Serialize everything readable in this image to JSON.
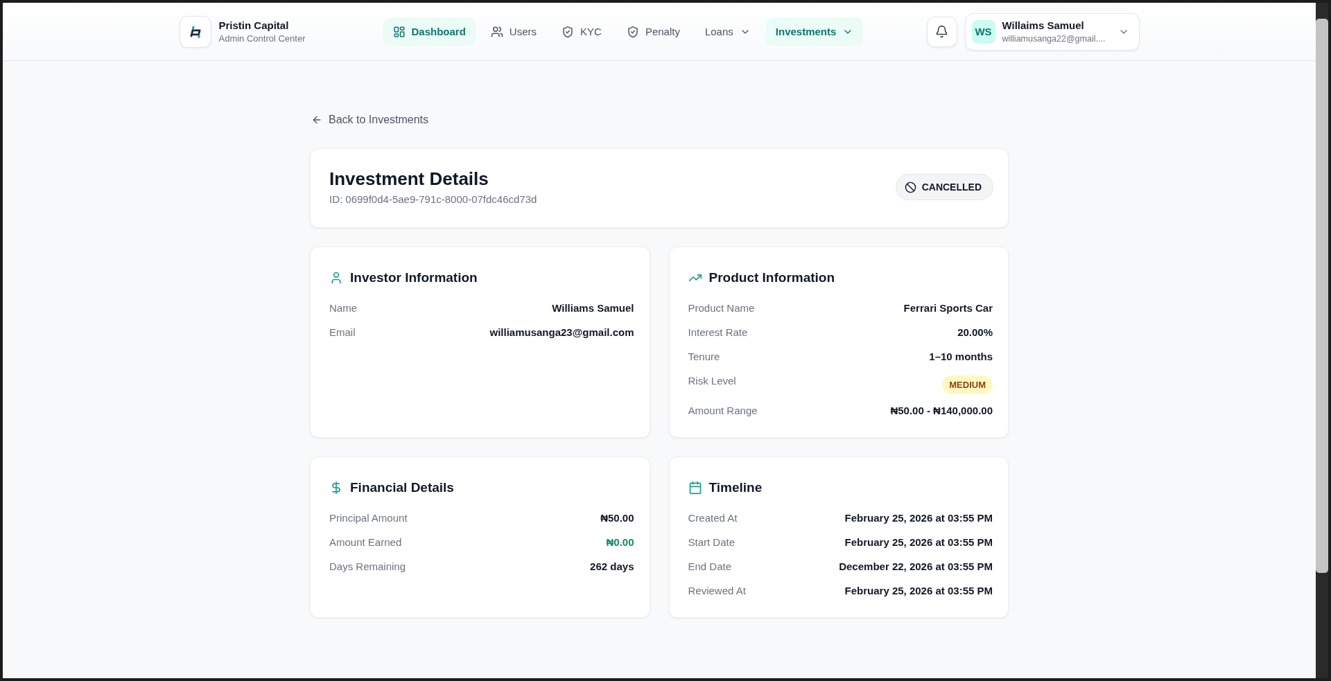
{
  "header": {
    "brand": {
      "name": "Pristin Capital",
      "subtitle": "Admin Control Center"
    },
    "nav": [
      {
        "label": "Dashboard",
        "kind": "link",
        "selected": true
      },
      {
        "label": "Users",
        "kind": "link",
        "selected": false
      },
      {
        "label": "KYC",
        "kind": "link",
        "selected": false
      },
      {
        "label": "Penalty",
        "kind": "link",
        "selected": false
      },
      {
        "label": "Loans",
        "kind": "dropdown",
        "selected": false
      },
      {
        "label": "Investments",
        "kind": "dropdown",
        "selected": true
      }
    ],
    "user": {
      "initials": "WS",
      "name": "Willaims Samuel",
      "email": "williamusanga22@gmail...."
    }
  },
  "back_link": {
    "label": "Back to Investments"
  },
  "investment": {
    "title": "Investment Details",
    "id": "ID: 0699f0d4-5ae9-791c-8000-07fdc46cd73d",
    "status": {
      "label": "CANCELLED",
      "kind": "cancelled"
    }
  },
  "sections": [
    {
      "title": "Investor Information",
      "rows": [
        {
          "label": "Name",
          "value": "Williams Samuel",
          "kind": "text"
        },
        {
          "label": "Email",
          "value": "williamusanga23@gmail.com",
          "kind": "text"
        }
      ]
    },
    {
      "title": "Product Information",
      "rows": [
        {
          "label": "Product Name",
          "value": "Ferrari Sports Car",
          "kind": "text"
        },
        {
          "label": "Interest Rate",
          "value": "20.00%",
          "kind": "text"
        },
        {
          "label": "Tenure",
          "value": "1–10 months",
          "kind": "text"
        },
        {
          "label": "Risk Level",
          "value": "MEDIUM",
          "kind": "badge"
        },
        {
          "label": "Amount Range",
          "value": "₦50.00 - ₦140,000.00",
          "kind": "text"
        }
      ]
    },
    {
      "title": "Financial Details",
      "rows": [
        {
          "label": "Principal Amount",
          "value": "₦50.00",
          "kind": "text"
        },
        {
          "label": "Amount Earned",
          "value": "₦0.00",
          "kind": "positive"
        },
        {
          "label": "Days Remaining",
          "value": "262 days",
          "kind": "text"
        }
      ]
    },
    {
      "title": "Timeline",
      "rows": [
        {
          "label": "Created At",
          "value": "February 25, 2026 at 03:55 PM",
          "kind": "text"
        },
        {
          "label": "Start Date",
          "value": "February 25, 2026 at 03:55 PM",
          "kind": "text"
        },
        {
          "label": "End Date",
          "value": "December 22, 2026 at 03:55 PM",
          "kind": "text"
        },
        {
          "label": "Reviewed At",
          "value": "February 25, 2026 at 03:55 PM",
          "kind": "text"
        }
      ]
    }
  ]
}
